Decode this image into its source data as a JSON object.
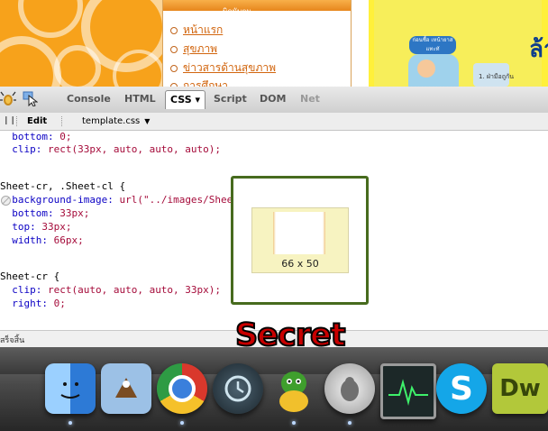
{
  "webpage": {
    "nav_header": "นิดนับตน",
    "nav_links": [
      "หน้าแรก",
      "สุขภาพ",
      "ข่าวสารด้านสุขภาพ",
      "การศึกษา"
    ],
    "ad_headline": "ล้า",
    "ad_badge": "ก่อนชื้อ เหน้ายาสแทะทั",
    "ad_caption": "1. ฝ่ามือถูกัน"
  },
  "firebug": {
    "tabs": [
      {
        "label": "Console",
        "state": "normal"
      },
      {
        "label": "HTML",
        "state": "normal"
      },
      {
        "label": "CSS ▾",
        "state": "active"
      },
      {
        "label": "Script",
        "state": "normal"
      },
      {
        "label": "DOM",
        "state": "normal"
      },
      {
        "label": "Net",
        "state": "disabled"
      }
    ],
    "edit_label": "Edit",
    "stylesheet": "template.css",
    "code": {
      "line1_prop": "  bottom:",
      "line1_val": " 0;",
      "line2_prop": "  clip:",
      "line2_val": " rect(33px, auto, auto, auto);",
      "sel1": "Sheet-cr, .Sheet-cl {",
      "line3_prop": "  background-image:",
      "line3_val": " url(\"../images/Sheet-v.png\");",
      "line4_prop": "  bottom:",
      "line4_val": " 33px;",
      "line5_prop": "  top:",
      "line5_val": " 33px;",
      "line6_prop": "  width:",
      "line6_val": " 66px;",
      "sel2": "Sheet-cr {",
      "line7_prop": "  clip:",
      "line7_val": " rect(auto, auto, auto, 33px);",
      "line8_prop": "  right:",
      "line8_val": " 0;"
    },
    "tooltip_dims": "66 x 50"
  },
  "status_text": "สร็จสิ้น",
  "overlay_label": "Secret",
  "dock_apps": [
    {
      "name": "Finder",
      "icon": "finder-icon",
      "color": "#3f8ee6"
    },
    {
      "name": "Mail",
      "icon": "mail-icon",
      "color": "#8fb8e0"
    },
    {
      "name": "Chrome",
      "icon": "chrome-icon",
      "color": "#d9382c"
    },
    {
      "name": "Time Machine",
      "icon": "time-machine-icon",
      "color": "#3a4a55"
    },
    {
      "name": "Adium",
      "icon": "adium-icon",
      "color": "#3f9f2d"
    },
    {
      "name": "Sequel Pro",
      "icon": "sequel-pro-icon",
      "color": "#d8d8d8"
    },
    {
      "name": "Activity Monitor",
      "icon": "activity-monitor-icon",
      "color": "#2a3a3a"
    },
    {
      "name": "Skype",
      "icon": "skype-icon",
      "color": "#14a6e8"
    },
    {
      "name": "Dreamweaver",
      "icon": "dreamweaver-icon",
      "color": "#7a9a1a",
      "glyph": "Dw"
    }
  ],
  "colors": {
    "property": "#0b00c4",
    "value": "#a50b3a",
    "tooltip_border": "#476b1e",
    "overlay_text": "#c80000"
  }
}
